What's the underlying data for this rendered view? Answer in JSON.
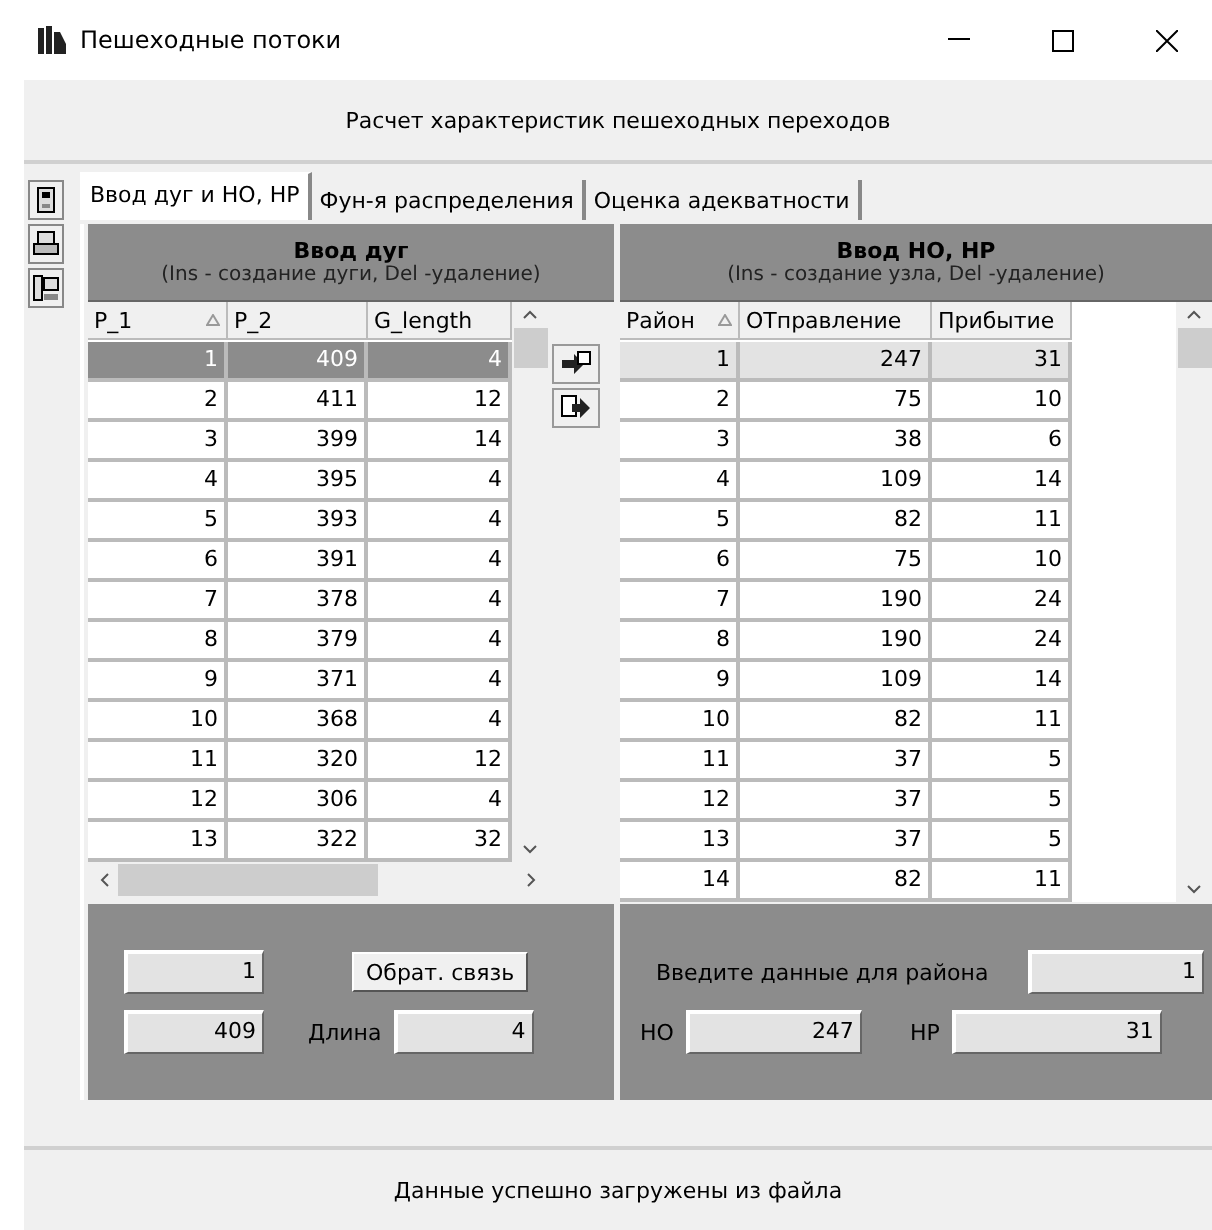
{
  "window": {
    "title": "Пешеходные потоки"
  },
  "header": "Расчет характеристик пешеходных переходов",
  "tabs": [
    {
      "label": "Ввод дуг и НО, НР",
      "selected": true
    },
    {
      "label": "Фун-я распределения",
      "selected": false
    },
    {
      "label": "Оценка адекватности",
      "selected": false
    }
  ],
  "arcs": {
    "title": "Ввод дуг",
    "subtitle": "(Ins - создание дуги, Del -удаление)",
    "focused": true,
    "columns": [
      {
        "label": "P_1",
        "sorted": true
      },
      {
        "label": "P_2",
        "sorted": false
      },
      {
        "label": "G_length",
        "sorted": false
      }
    ],
    "rows": [
      {
        "cells": [
          "1",
          "409",
          "4"
        ],
        "selected": true
      },
      {
        "cells": [
          "2",
          "411",
          "12"
        ],
        "selected": false
      },
      {
        "cells": [
          "3",
          "399",
          "14"
        ],
        "selected": false
      },
      {
        "cells": [
          "4",
          "395",
          "4"
        ],
        "selected": false
      },
      {
        "cells": [
          "5",
          "393",
          "4"
        ],
        "selected": false
      },
      {
        "cells": [
          "6",
          "391",
          "4"
        ],
        "selected": false
      },
      {
        "cells": [
          "7",
          "378",
          "4"
        ],
        "selected": false
      },
      {
        "cells": [
          "8",
          "379",
          "4"
        ],
        "selected": false
      },
      {
        "cells": [
          "9",
          "371",
          "4"
        ],
        "selected": false
      },
      {
        "cells": [
          "10",
          "368",
          "4"
        ],
        "selected": false
      },
      {
        "cells": [
          "11",
          "320",
          "12"
        ],
        "selected": false
      },
      {
        "cells": [
          "12",
          "306",
          "4"
        ],
        "selected": false
      },
      {
        "cells": [
          "13",
          "322",
          "32"
        ],
        "selected": false
      }
    ]
  },
  "nodes": {
    "title": "Ввод НО, НР",
    "subtitle": "(Ins - создание узла, Del -удаление)",
    "focused": false,
    "columns": [
      {
        "label": "Район",
        "sorted": true
      },
      {
        "label": "ОТправление",
        "sorted": false
      },
      {
        "label": "Прибытие",
        "sorted": false
      }
    ],
    "rows": [
      {
        "cells": [
          "1",
          "247",
          "31"
        ],
        "selected": true
      },
      {
        "cells": [
          "2",
          "75",
          "10"
        ],
        "selected": false
      },
      {
        "cells": [
          "3",
          "38",
          "6"
        ],
        "selected": false
      },
      {
        "cells": [
          "4",
          "109",
          "14"
        ],
        "selected": false
      },
      {
        "cells": [
          "5",
          "82",
          "11"
        ],
        "selected": false
      },
      {
        "cells": [
          "6",
          "75",
          "10"
        ],
        "selected": false
      },
      {
        "cells": [
          "7",
          "190",
          "24"
        ],
        "selected": false
      },
      {
        "cells": [
          "8",
          "190",
          "24"
        ],
        "selected": false
      },
      {
        "cells": [
          "9",
          "109",
          "14"
        ],
        "selected": false
      },
      {
        "cells": [
          "10",
          "82",
          "11"
        ],
        "selected": false
      },
      {
        "cells": [
          "11",
          "37",
          "5"
        ],
        "selected": false
      },
      {
        "cells": [
          "12",
          "37",
          "5"
        ],
        "selected": false
      },
      {
        "cells": [
          "13",
          "37",
          "5"
        ],
        "selected": false
      },
      {
        "cells": [
          "14",
          "82",
          "11"
        ],
        "selected": false
      }
    ]
  },
  "arc_form": {
    "p1": "1",
    "p2": "409",
    "feedback_button": "Обрат. связь",
    "length_label": "Длина",
    "length": "4"
  },
  "node_form": {
    "prompt": "Введите данные для района",
    "district": "1",
    "ho_label": "НО",
    "ho": "247",
    "hp_label": "НР",
    "hp": "31"
  },
  "status_bar": "Данные успешно загружены из файла"
}
